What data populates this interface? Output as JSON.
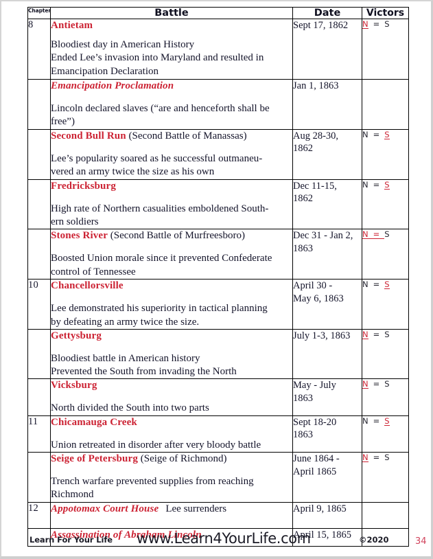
{
  "table": {
    "headers": {
      "chapter": "Chapter",
      "battle": "Battle",
      "date": "Date",
      "victors": "Victors"
    },
    "rows": [
      {
        "chapter": "8",
        "title": "Antietam",
        "title_style": "bold",
        "alt": "",
        "note": "",
        "description": "Bloodiest day in American History\nEnded Lee’s invasion into Maryland and resulted in\nEmancipation Declaration",
        "date": "Sept 17, 1862",
        "victors": {
          "north": "N",
          "equals": "=",
          "south": "S",
          "winner": "north"
        }
      },
      {
        "chapter": "",
        "title": "Emancipation Proclamation",
        "title_style": "italic",
        "alt": "",
        "note": "",
        "description": "Lincoln declared slaves (“are and henceforth shall be\nfree”)",
        "date": "Jan 1, 1863",
        "victors": {
          "north": "",
          "equals": "",
          "south": "",
          "winner": "none"
        }
      },
      {
        "chapter": "",
        "title": "Second Bull Run",
        "title_style": "bold",
        "alt": "(Second Battle of Manassas)",
        "note": "",
        "description": "Lee’s popularity soared as he successful outmaneu-\nvered an army twice the size as his own",
        "date": "Aug 28-30,\n1862",
        "victors": {
          "north": "N",
          "equals": "=",
          "south": "S",
          "winner": "south"
        }
      },
      {
        "chapter": "",
        "title": "Fredricksburg",
        "title_style": "bold",
        "alt": "",
        "note": "",
        "description": "High rate of Northern casualities emboldened South-\nern soldiers",
        "date": "Dec  11-15,\n1862",
        "victors": {
          "north": "N",
          "equals": "=",
          "south": "S",
          "winner": "south"
        }
      },
      {
        "chapter": "",
        "title": "Stones  River",
        "title_style": "bold",
        "alt": "(Second Battle of Murfreesboro)",
        "note": "",
        "description": "Boosted Union morale since it prevented Confederate\ncontrol of Tennessee",
        "date": "Dec 31 - Jan 2,\n1863",
        "victors": {
          "north": "N",
          "equals": "=",
          "south": "S",
          "winner": "north-equals"
        }
      },
      {
        "chapter": "10",
        "title": "Chancellorsville",
        "title_style": "bold",
        "alt": "",
        "note": "",
        "description": "Lee demonstrated his superiority in tactical planning\nby defeating an army twice the size.",
        "date": "April 30 -\nMay 6, 1863",
        "victors": {
          "north": "N",
          "equals": "=",
          "south": "S",
          "winner": "south"
        }
      },
      {
        "chapter": "",
        "title": "Gettysburg",
        "title_style": "bold",
        "alt": "",
        "note": "",
        "description": "Bloodiest battle in American history\nPrevented the South from invading the North",
        "date": "July 1-3, 1863",
        "victors": {
          "north": "N",
          "equals": "=",
          "south": "S",
          "winner": "north"
        }
      },
      {
        "chapter": "",
        "title": "Vicksburg",
        "title_style": "bold",
        "alt": "",
        "note": "",
        "description": "North divided the South into two parts",
        "date": "May - July\n1863",
        "victors": {
          "north": "N",
          "equals": "=",
          "south": "S",
          "winner": "north"
        }
      },
      {
        "chapter": "11",
        "title": "Chicamauga Creek",
        "title_style": "bold",
        "alt": "",
        "note": "",
        "description": "Union retreated in disorder after very bloody battle",
        "date": "Sept  18-20\n1863",
        "victors": {
          "north": "N",
          "equals": "=",
          "south": "S",
          "winner": "south"
        }
      },
      {
        "chapter": "",
        "title": "Seige of Petersburg",
        "title_style": "bold",
        "alt": "(Seige of Richmond)",
        "note": "",
        "description": "Trench warfare prevented supplies from reaching\nRichmond",
        "date": "June 1864 -\nApril 1865",
        "victors": {
          "north": "N",
          "equals": "=",
          "south": "S",
          "winner": "north"
        }
      },
      {
        "chapter": "12",
        "title": "Appotomax Court House",
        "title_style": "italic",
        "alt": "",
        "note": "Lee surrenders",
        "description": "",
        "date": "April 9, 1865",
        "victors": {
          "north": "",
          "equals": "",
          "south": "",
          "winner": "none"
        }
      },
      {
        "chapter": "",
        "title": "Assassination of Abraham Lincoln",
        "title_style": "italic",
        "alt": "",
        "note": "",
        "description": "",
        "date": "April 15, 1865",
        "victors": {
          "north": "",
          "equals": "",
          "south": "",
          "winner": "none"
        }
      }
    ]
  },
  "footer": {
    "brand": "Learn For Your Life",
    "url": "www.Learn4YourLife.com",
    "copyright": "©2020",
    "page_number": "34"
  },
  "colors": {
    "accent_red": "#cc2233",
    "text": "#14142a",
    "page_number_red": "#d1435c"
  }
}
